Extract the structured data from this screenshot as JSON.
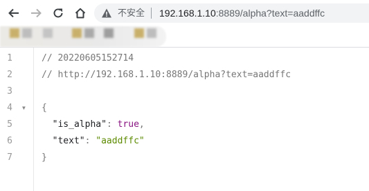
{
  "browser": {
    "security_label": "不安全",
    "url_host": "192.168.1.10",
    "url_rest": ":8889/alpha?text=aaddffc",
    "bookmark_colors": [
      "#c9b06a",
      "#bdbdbd",
      "#c4c4c4",
      "#c9b06a",
      "#a9a9a9",
      "#9e9e9e",
      "#c9b06a",
      "#bdbdbd"
    ]
  },
  "viewer": {
    "lines": [
      {
        "n": "1",
        "comment": "// 20220605152714"
      },
      {
        "n": "2",
        "comment": "// http://192.168.1.10:8889/alpha?text=aaddffc"
      },
      {
        "n": "3"
      },
      {
        "n": "4",
        "open": "{"
      },
      {
        "n": "5",
        "key": "\"is_alpha\"",
        "colon": ": ",
        "value": "true",
        "comma": ","
      },
      {
        "n": "6",
        "key": "\"text\"",
        "colon": ": ",
        "value": "\"aaddffc\""
      },
      {
        "n": "7",
        "close": "}"
      }
    ]
  }
}
